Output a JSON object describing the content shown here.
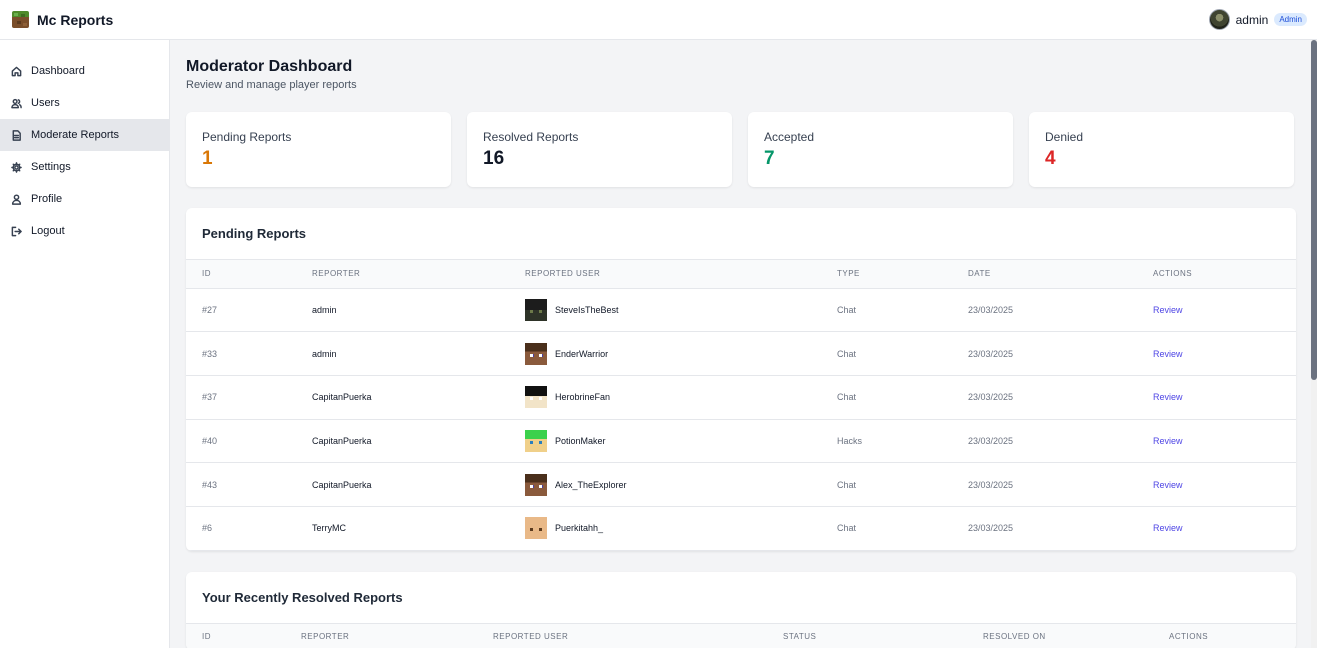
{
  "app": {
    "title": "Mc Reports"
  },
  "user": {
    "name": "admin",
    "role": "Admin"
  },
  "sidebar": {
    "items": [
      {
        "label": "Dashboard",
        "icon": "home-icon"
      },
      {
        "label": "Users",
        "icon": "users-icon"
      },
      {
        "label": "Moderate Reports",
        "icon": "document-icon",
        "active": true
      },
      {
        "label": "Settings",
        "icon": "gear-icon"
      },
      {
        "label": "Profile",
        "icon": "user-icon"
      },
      {
        "label": "Logout",
        "icon": "logout-icon"
      }
    ]
  },
  "page": {
    "title": "Moderator Dashboard",
    "subtitle": "Review and manage player reports"
  },
  "stats": [
    {
      "label": "Pending Reports",
      "value": "1",
      "color": "#d97706"
    },
    {
      "label": "Resolved Reports",
      "value": "16",
      "color": "#111827"
    },
    {
      "label": "Accepted",
      "value": "7",
      "color": "#059669"
    },
    {
      "label": "Denied",
      "value": "4",
      "color": "#dc2626"
    }
  ],
  "pending": {
    "title": "Pending Reports",
    "columns": [
      "ID",
      "REPORTER",
      "REPORTED USER",
      "TYPE",
      "DATE",
      "ACTIONS"
    ],
    "rows": [
      {
        "id": "#27",
        "reporter": "admin",
        "reported": "SteveIsTheBest",
        "type": "Chat",
        "date": "23/03/2025",
        "action": "Review"
      },
      {
        "id": "#33",
        "reporter": "admin",
        "reported": "EnderWarrior",
        "type": "Chat",
        "date": "23/03/2025",
        "action": "Review"
      },
      {
        "id": "#37",
        "reporter": "CapitanPuerka",
        "reported": "HerobrineFan",
        "type": "Chat",
        "date": "23/03/2025",
        "action": "Review"
      },
      {
        "id": "#40",
        "reporter": "CapitanPuerka",
        "reported": "PotionMaker",
        "type": "Hacks",
        "date": "23/03/2025",
        "action": "Review"
      },
      {
        "id": "#43",
        "reporter": "CapitanPuerka",
        "reported": "Alex_TheExplorer",
        "type": "Chat",
        "date": "23/03/2025",
        "action": "Review"
      },
      {
        "id": "#6",
        "reporter": "TerryMC",
        "reported": "Puerkitahh_",
        "type": "Chat",
        "date": "23/03/2025",
        "action": "Review"
      }
    ]
  },
  "resolved": {
    "title": "Your Recently Resolved Reports",
    "columns": [
      "ID",
      "REPORTER",
      "REPORTED USER",
      "STATUS",
      "RESOLVED ON",
      "ACTIONS"
    ]
  }
}
